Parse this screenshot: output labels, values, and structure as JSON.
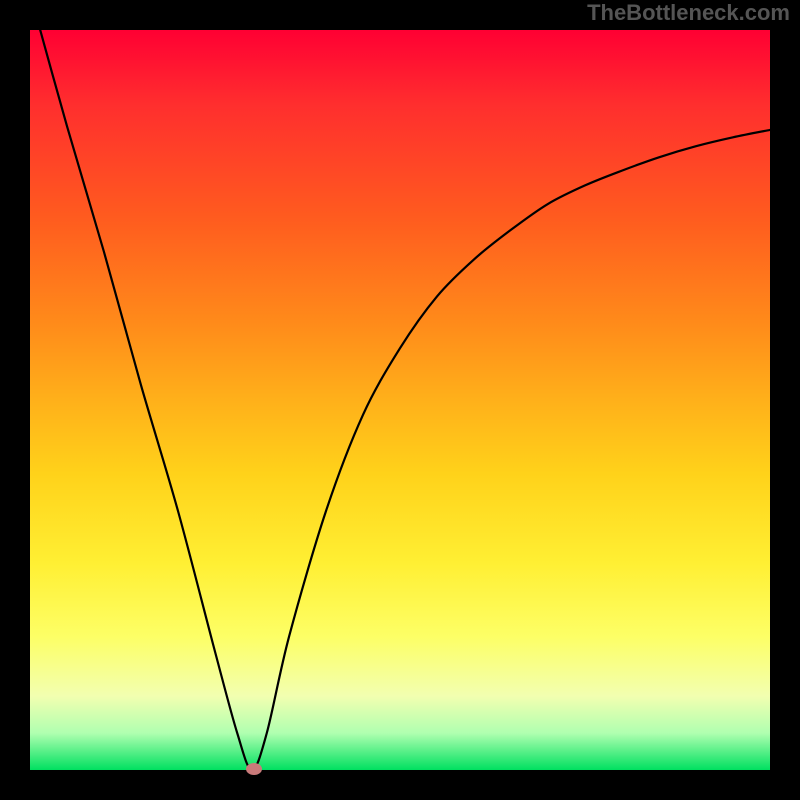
{
  "watermark": "TheBottleneck.com",
  "chart_data": {
    "type": "line",
    "title": "",
    "xlabel": "",
    "ylabel": "",
    "xlim": [
      0,
      100
    ],
    "ylim": [
      0,
      100
    ],
    "grid": false,
    "series": [
      {
        "name": "curve",
        "x": [
          0,
          5,
          10,
          15,
          20,
          25,
          28,
          30,
          32,
          35,
          40,
          45,
          50,
          55,
          60,
          65,
          70,
          75,
          80,
          85,
          90,
          95,
          100
        ],
        "values": [
          105,
          87,
          70,
          52,
          35,
          16,
          5,
          0,
          5,
          18,
          35,
          48,
          57,
          64,
          69,
          73,
          76.5,
          79,
          81,
          82.8,
          84.3,
          85.5,
          86.5
        ]
      }
    ],
    "annotations": [
      {
        "type": "marker",
        "x": 30.3,
        "y": 0.2,
        "color": "#c97a7a"
      }
    ],
    "background_gradient": {
      "top": "#ff0033",
      "bottom": "#00e060"
    }
  }
}
